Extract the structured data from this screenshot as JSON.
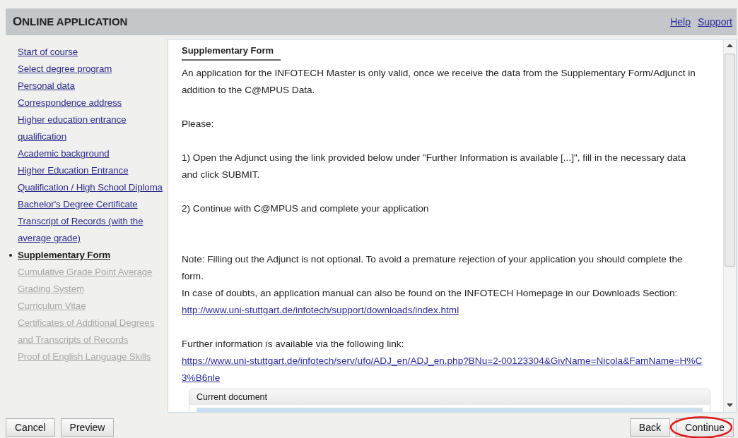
{
  "header": {
    "title": "ONLINE APPLICATION",
    "links": [
      "Help",
      "Support"
    ]
  },
  "sidebar": {
    "items": [
      {
        "label": "Start of course",
        "selected": false,
        "disabled": false
      },
      {
        "label": "Select degree program",
        "selected": false,
        "disabled": false
      },
      {
        "label": "Personal data",
        "selected": false,
        "disabled": false
      },
      {
        "label": "Correspondence address",
        "selected": false,
        "disabled": false
      },
      {
        "label": "Higher education entrance qualification",
        "selected": false,
        "disabled": false
      },
      {
        "label": "Academic background",
        "selected": false,
        "disabled": false
      },
      {
        "label": "Higher Education Entrance Qualification / High School Diploma",
        "selected": false,
        "disabled": false
      },
      {
        "label": "Bachelor's Degree Certificate",
        "selected": false,
        "disabled": false
      },
      {
        "label": "Transcript of Records (with the average grade)",
        "selected": false,
        "disabled": false
      },
      {
        "label": "Supplementary Form",
        "selected": true,
        "disabled": false
      },
      {
        "label": "Cumulative Grade Point Average",
        "selected": false,
        "disabled": true
      },
      {
        "label": "Grading System",
        "selected": false,
        "disabled": true
      },
      {
        "label": "Curriculum Vitae",
        "selected": false,
        "disabled": true
      },
      {
        "label": "Certificates of Additional Degrees and Transcripts of Records",
        "selected": false,
        "disabled": true
      },
      {
        "label": "Proof of English Language Skills",
        "selected": false,
        "disabled": true
      }
    ]
  },
  "content": {
    "heading": "Supplementary Form",
    "blocks": [
      {
        "kind": "text",
        "text": "An application for the INFOTECH Master is only valid, once we receive the data from the Supplementary Form/Adjunct in addition to the C@MPUS Data."
      },
      {
        "kind": "gap"
      },
      {
        "kind": "text",
        "text": "Please:"
      },
      {
        "kind": "gap"
      },
      {
        "kind": "text",
        "text": "1) Open the Adjunct using the link provided below under \"Further Information is available [...]\", fill in the necessary data and click SUBMIT."
      },
      {
        "kind": "gap"
      },
      {
        "kind": "text",
        "text": "2) Continue with C@MPUS and complete your application"
      },
      {
        "kind": "gap"
      },
      {
        "kind": "gap"
      },
      {
        "kind": "text",
        "text": "Note: Filling out the Adjunct is not optional. To avoid a premature rejection of your application you should complete the form."
      },
      {
        "kind": "text",
        "text": "In case of doubts, an application manual can also be found on the INFOTECH Homepage in our Downloads Section:"
      },
      {
        "kind": "link",
        "text": "http://www.uni-stuttgart.de/infotech/support/downloads/index.html"
      },
      {
        "kind": "gap"
      },
      {
        "kind": "text",
        "text": "Further information is available via the following link:"
      },
      {
        "kind": "link",
        "text": "https://www.uni-stuttgart.de/infotech/serv/ufo/ADJ_en/ADJ_en.php?BNu=2-00123304&GivName=Nicola&FamName=H%C3%B6nle"
      }
    ],
    "document_panel": {
      "title": "Current document"
    }
  },
  "footer": {
    "left_buttons": [
      "Cancel",
      "Preview"
    ],
    "right_buttons": [
      {
        "label": "Back",
        "highlighted": false
      },
      {
        "label": "Continue",
        "highlighted": true
      }
    ]
  }
}
